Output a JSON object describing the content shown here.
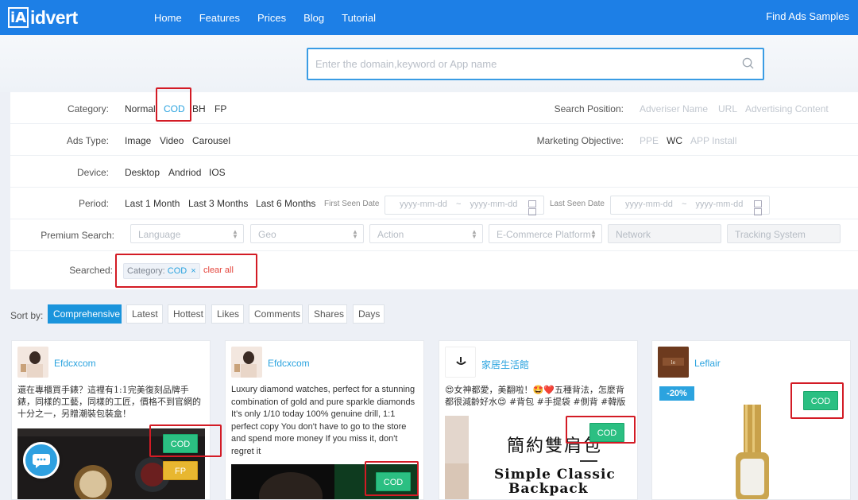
{
  "nav": {
    "logo_letters": "iA",
    "logo_name": "idvert",
    "menu": [
      "Home",
      "Features",
      "Prices",
      "Blog",
      "Tutorial"
    ],
    "right_link": "Find Ads Samples",
    "bg_color": "#1d7fe6"
  },
  "search": {
    "placeholder": "Enter the domain,keyword or App name",
    "icon": "search-icon"
  },
  "filters": {
    "category": {
      "label": "Category:",
      "options": [
        "Normal",
        "COD",
        "BH",
        "FP"
      ],
      "selected": "COD"
    },
    "search_position": {
      "label": "Search Position:",
      "options": [
        "Adveriser Name",
        "URL",
        "Advertising Content"
      ]
    },
    "ads_type": {
      "label": "Ads Type:",
      "options": [
        "Image",
        "Video",
        "Carousel"
      ]
    },
    "marketing_objective": {
      "label": "Marketing Objective:",
      "options": [
        "PPE",
        "WC",
        "APP Install"
      ],
      "selected": "WC"
    },
    "device": {
      "label": "Device:",
      "options": [
        "Desktop",
        "Andriod",
        "IOS"
      ]
    },
    "period": {
      "label": "Period:",
      "options": [
        "Last 1 Month",
        "Last 3 Months",
        "Last 6 Months"
      ],
      "first_seen_label": "First Seen Date",
      "last_seen_label": "Last Seen Date",
      "date_placeholder": "yyyy-mm-dd",
      "separator": "~"
    },
    "premium_search": {
      "label": "Premium Search:",
      "selects": [
        "Language",
        "Geo",
        "Action",
        "E-Commerce Platform",
        "Network",
        "Tracking System"
      ]
    },
    "searched": {
      "label": "Searched:",
      "tag_key": "Category:",
      "tag_value": "COD",
      "tag_close": "×",
      "clear_label": "clear all"
    }
  },
  "sort": {
    "label": "Sort by:",
    "options": [
      "Comprehensive",
      "Latest",
      "Hottest",
      "Likes",
      "Comments",
      "Shares",
      "Days"
    ],
    "selected": "Comprehensive"
  },
  "cards": [
    {
      "advertiser": "Efdcxcom",
      "text": "還在專櫃買手錶？這裡有1:1完美復刻品牌手錶，同樣的工藝，同樣的工匠，價格不到官網的十分之一，另贈潮裝包裝盒！",
      "badges": [
        "COD",
        "FP"
      ]
    },
    {
      "advertiser": "Efdcxcom",
      "text": "Luxury diamond watches, perfect for a stunning combination of gold and pure sparkle diamonds It's only 1/10 today 100% genuine drill, 1:1 perfect copy You don't have to go to the store and spend more money If you miss it, don't regret it",
      "badges": [
        "COD"
      ]
    },
    {
      "advertiser": "家居生活館",
      "text": "😍女神都愛，美翻啦！🤩❤️五種背法，怎麼背都很減齡好水😍 #背包 #手提袋 #側背 #韓版",
      "badges": [
        "COD"
      ],
      "image_title": "簡約雙肩包",
      "image_subtitle_1": "Simple Classic",
      "image_subtitle_2": "Backpack"
    },
    {
      "advertiser": "Leflair",
      "text": "",
      "badges": [
        "COD"
      ],
      "discount": "-20%"
    }
  ],
  "colors": {
    "accent": "#2ba3df",
    "highlight_red": "#d31b25",
    "cod_green": "#2bbf82",
    "fp_yellow": "#e8b730"
  }
}
